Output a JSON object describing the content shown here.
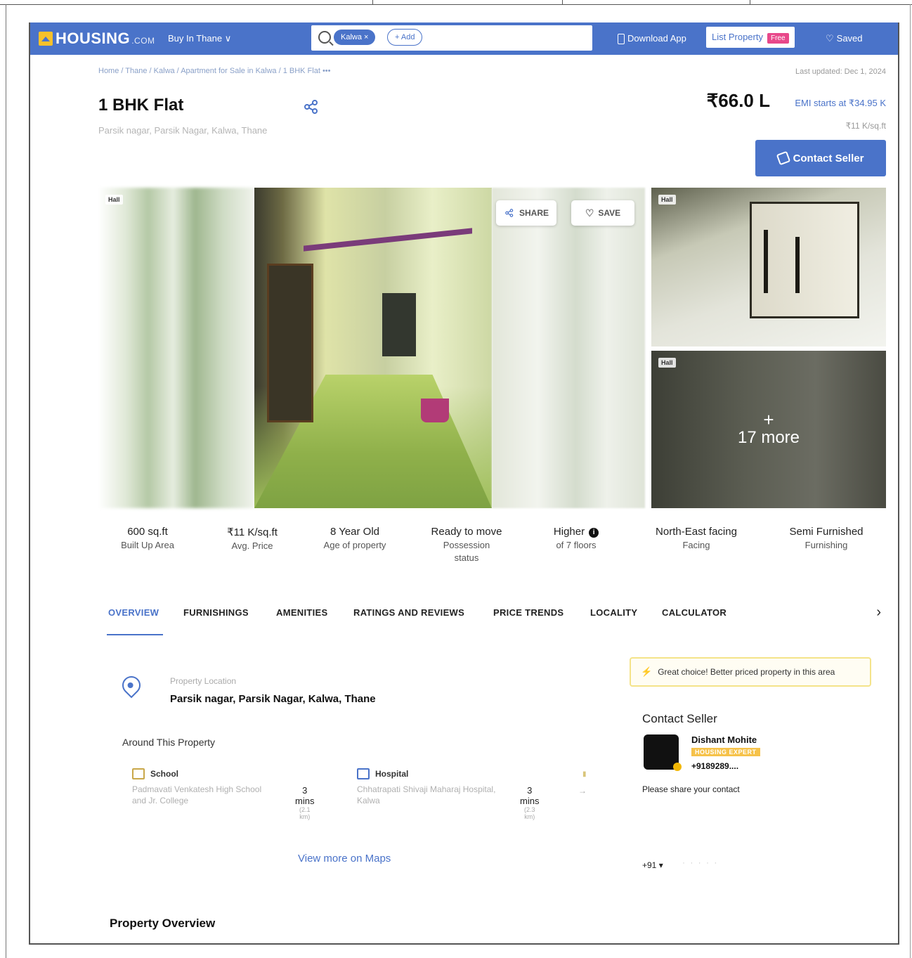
{
  "header": {
    "logo": "HOUSING",
    "logo_suffix": ".COM",
    "city_selector": "Buy In Thane ∨",
    "search_chip": "Kalwa ×",
    "search_add": "+ Add",
    "download_app": "Download App",
    "list_property": "List Property",
    "free_badge": "Free",
    "saved": "Saved"
  },
  "breadcrumb": "Home / Thane / Kalwa / Apartment for Sale in Kalwa / 1 BHK Flat   •••",
  "last_updated": "Last updated: Dec 1, 2024",
  "listing": {
    "title": "1 BHK Flat",
    "address": "Parsik nagar, Parsik Nagar, Kalwa, Thane",
    "price": "₹66.0 L",
    "emi": "EMI starts at ₹34.95 K",
    "per_sqft": "₹11 K/sq.ft",
    "contact_button": "Contact Seller"
  },
  "gallery": {
    "share_button": "SHARE",
    "save_button": "SAVE",
    "tag_hall": "Hall",
    "more_plus": "+",
    "more_count": "17 more"
  },
  "facts": [
    {
      "value": "600 sq.ft",
      "label": "Built Up Area"
    },
    {
      "value": "₹11 K/sq.ft",
      "label": "Avg. Price"
    },
    {
      "value": "8 Year Old",
      "label": "Age of property"
    },
    {
      "value": "Ready to move",
      "label": "Possession status"
    },
    {
      "value": "Higher",
      "label": "of 7 floors"
    },
    {
      "value": "North-East facing",
      "label": "Facing"
    },
    {
      "value": "Semi Furnished",
      "label": "Furnishing"
    }
  ],
  "tabs": [
    "OVERVIEW",
    "FURNISHINGS",
    "AMENITIES",
    "RATINGS AND REVIEWS",
    "PRICE TRENDS",
    "LOCALITY",
    "CALCULATOR"
  ],
  "location": {
    "label": "Property Location",
    "value": "Parsik nagar, Parsik Nagar, Kalwa, Thane"
  },
  "around": {
    "title": "Around This Property",
    "items": [
      {
        "category": "School",
        "name": "Padmavati Venkatesh High School and Jr. College",
        "time": "3 mins",
        "distance": "(2.1 km)"
      },
      {
        "category": "Hospital",
        "name": "Chhatrapati Shivaji Maharaj Hospital, Kalwa",
        "time": "3 mins",
        "distance": "(2.3 km)"
      }
    ],
    "view_more": "View more on Maps"
  },
  "right_panel": {
    "great_choice": "Great choice! Better priced property in this area",
    "contact_title": "Contact Seller",
    "agent_name": "Dishant Mohite",
    "agent_badge": "HOUSING EXPERT",
    "agent_phone": "+9189289....",
    "share_contact": "Please share your contact",
    "country_code": "+91 ▾"
  },
  "overview_heading": "Property Overview"
}
